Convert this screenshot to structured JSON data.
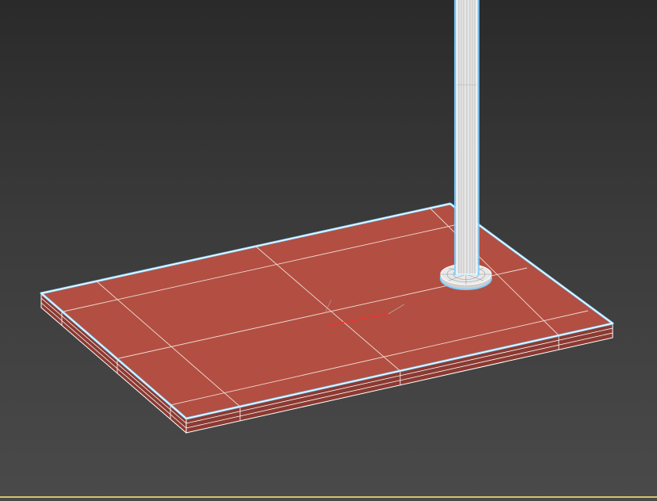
{
  "viewport": {
    "background_top": "#2a2a2a",
    "background_bottom": "#4a4a4a",
    "active_frame_color": "#d2c46a"
  },
  "scene": {
    "base_plate_color": "#b24f42",
    "base_side_color": "#8b3a32",
    "wire_color": "#ffffff",
    "selection_glow_color": "#7fd0ff",
    "pivot_axis_color": "#ff2a2a",
    "objects": [
      "base-plate",
      "rod",
      "rod-collar"
    ]
  }
}
